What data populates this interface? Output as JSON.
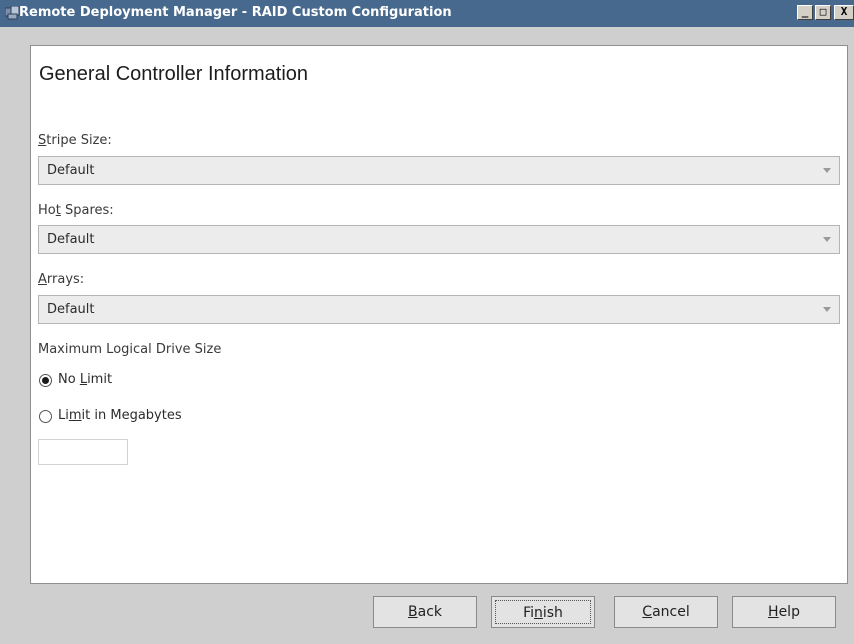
{
  "window": {
    "title": "Remote Deployment Manager - RAID Custom Configuration",
    "controls": {
      "minimize": "_",
      "maximize": "□",
      "close": "X"
    }
  },
  "panel": {
    "heading": "General Controller Information",
    "stripe_size": {
      "label_mnemonic": "S",
      "label_rest": "tripe Size:",
      "value": "Default"
    },
    "hot_spares": {
      "label_pre": "Ho",
      "label_mnemonic": "t",
      "label_rest": " Spares:",
      "value": "Default"
    },
    "arrays": {
      "label_mnemonic": "A",
      "label_rest": "rrays:",
      "value": "Default"
    },
    "max_drive_size": {
      "label": "Maximum Logical Drive Size",
      "no_limit": {
        "pre": "No ",
        "mnemonic": "L",
        "rest": "imit",
        "checked": true
      },
      "limit_mb": {
        "pre": "Li",
        "mnemonic": "m",
        "rest": "it in Megabytes",
        "checked": false
      },
      "megabytes_value": ""
    }
  },
  "buttons": {
    "back": {
      "mnemonic": "B",
      "rest": "ack"
    },
    "finish": {
      "pre": "Fi",
      "mnemonic": "n",
      "rest": "ish"
    },
    "cancel": {
      "mnemonic": "C",
      "rest": "ancel"
    },
    "help": {
      "mnemonic": "H",
      "rest": "elp"
    }
  },
  "icons": {
    "app": "app-window-icon",
    "dropdown": "chevron-down-icon",
    "radio": "radio-icon"
  },
  "colors": {
    "title_bar": "#47698e",
    "window_bg": "#cfcfcf",
    "panel_bg": "#ffffff"
  }
}
